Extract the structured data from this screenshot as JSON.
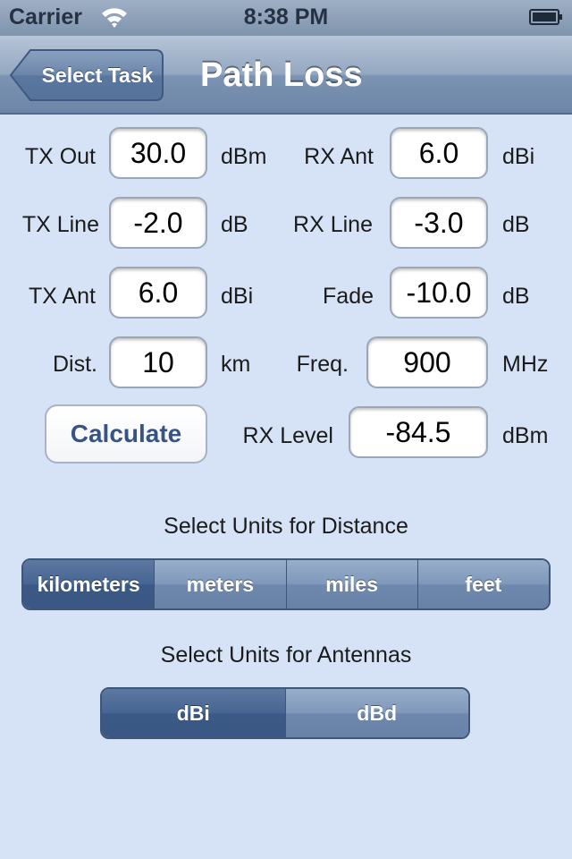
{
  "status_bar": {
    "carrier": "Carrier",
    "time": "8:38 PM"
  },
  "nav": {
    "back_label": "Select Task",
    "title": "Path Loss"
  },
  "form": {
    "tx_out": {
      "label": "TX Out",
      "value": "30.0",
      "unit": "dBm"
    },
    "rx_ant": {
      "label": "RX Ant",
      "value": "6.0",
      "unit": "dBi"
    },
    "tx_line": {
      "label": "TX Line",
      "value": "-2.0",
      "unit": "dB"
    },
    "rx_line": {
      "label": "RX Line",
      "value": "-3.0",
      "unit": "dB"
    },
    "tx_ant": {
      "label": "TX Ant",
      "value": "6.0",
      "unit": "dBi"
    },
    "fade": {
      "label": "Fade",
      "value": "-10.0",
      "unit": "dB"
    },
    "dist": {
      "label": "Dist.",
      "value": "10",
      "unit": "km"
    },
    "freq": {
      "label": "Freq.",
      "value": "900",
      "unit": "MHz"
    },
    "rx_level": {
      "label": "RX Level",
      "value": "-84.5",
      "unit": "dBm"
    },
    "calculate_label": "Calculate"
  },
  "distance_units": {
    "title": "Select Units for Distance",
    "options": [
      "kilometers",
      "meters",
      "miles",
      "feet"
    ],
    "selected": "kilometers"
  },
  "antenna_units": {
    "title": "Select Units for Antennas",
    "options": [
      "dBi",
      "dBd"
    ],
    "selected": "dBi"
  },
  "colors": {
    "background": "#d6e3f7",
    "nav_bar": "#7c93b2",
    "calculate_text": "#385487",
    "segment_selected": "#476593"
  }
}
